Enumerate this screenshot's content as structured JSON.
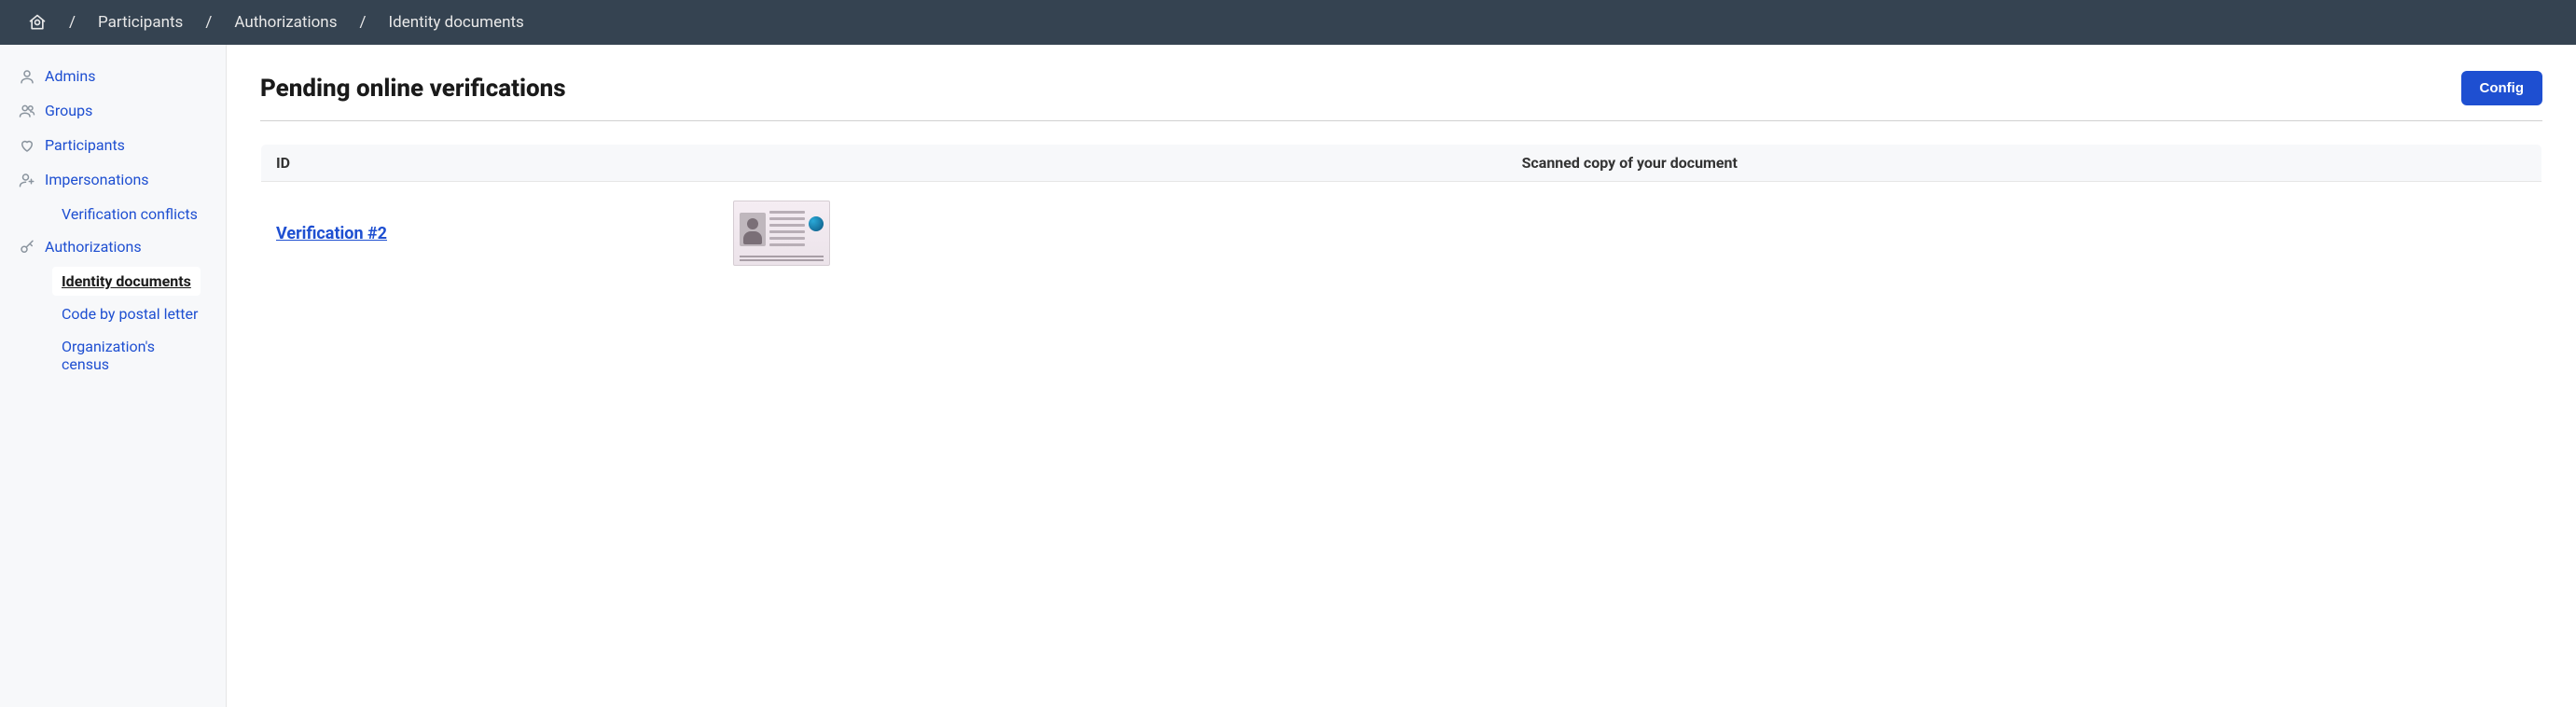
{
  "breadcrumbs": {
    "items": [
      {
        "label": "Participants"
      },
      {
        "label": "Authorizations"
      },
      {
        "label": "Identity documents"
      }
    ]
  },
  "sidebar": {
    "items": [
      {
        "label": "Admins",
        "icon": "user-icon"
      },
      {
        "label": "Groups",
        "icon": "users-icon"
      },
      {
        "label": "Participants",
        "icon": "heart-hands-icon"
      },
      {
        "label": "Impersonations",
        "icon": "user-plus-icon"
      },
      {
        "label": "Authorizations",
        "icon": "key-icon"
      }
    ],
    "impersonationsSub": [
      {
        "label": "Verification conflicts"
      }
    ],
    "authorizationsSub": [
      {
        "label": "Identity documents",
        "active": true
      },
      {
        "label": "Code by postal letter"
      },
      {
        "label": "Organization's census"
      }
    ]
  },
  "page": {
    "title": "Pending online verifications",
    "configButton": "Config"
  },
  "table": {
    "headers": {
      "id": "ID",
      "scan": "Scanned copy of your document"
    },
    "rows": [
      {
        "id_label": "Verification #2"
      }
    ]
  }
}
